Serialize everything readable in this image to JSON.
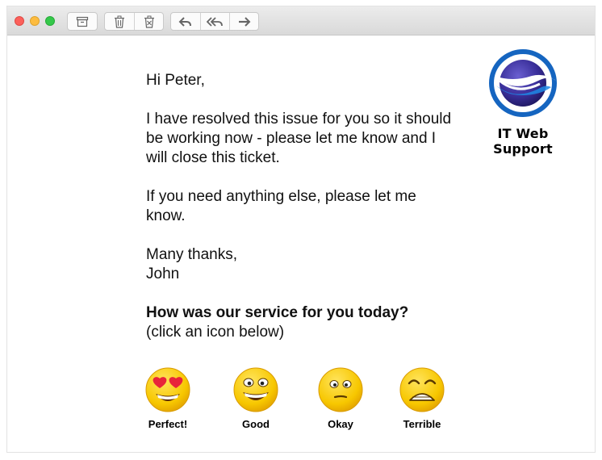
{
  "toolbar": {
    "traffic_lights": [
      "close",
      "minimize",
      "zoom"
    ],
    "groups": [
      [
        "archive-icon"
      ],
      [
        "trash-icon",
        "junk-icon"
      ],
      [
        "reply-icon",
        "reply-all-icon",
        "forward-icon"
      ]
    ]
  },
  "email": {
    "greeting": "Hi Peter,",
    "body1": "I have resolved this issue for you so it should be working now - please let me know and I will close this ticket.",
    "body2": "If you need anything else, please let me know.",
    "closing": "Many thanks,",
    "signature": "John",
    "question": "How was our service for you today?",
    "hint": "(click an icon below)"
  },
  "logo": {
    "text": "IT Web Support",
    "colors": {
      "ring": "#1565c0",
      "globe": "#2e2a80"
    }
  },
  "rating": {
    "options": [
      {
        "label": "Perfect!",
        "icon": "heart-eyes-emoji-icon"
      },
      {
        "label": "Good",
        "icon": "grinning-emoji-icon"
      },
      {
        "label": "Okay",
        "icon": "neutral-emoji-icon"
      },
      {
        "label": "Terrible",
        "icon": "distressed-emoji-icon"
      }
    ],
    "colors": {
      "face": "#f7c700",
      "face_edge": "#d99b00",
      "heart": "#e8253a"
    }
  }
}
